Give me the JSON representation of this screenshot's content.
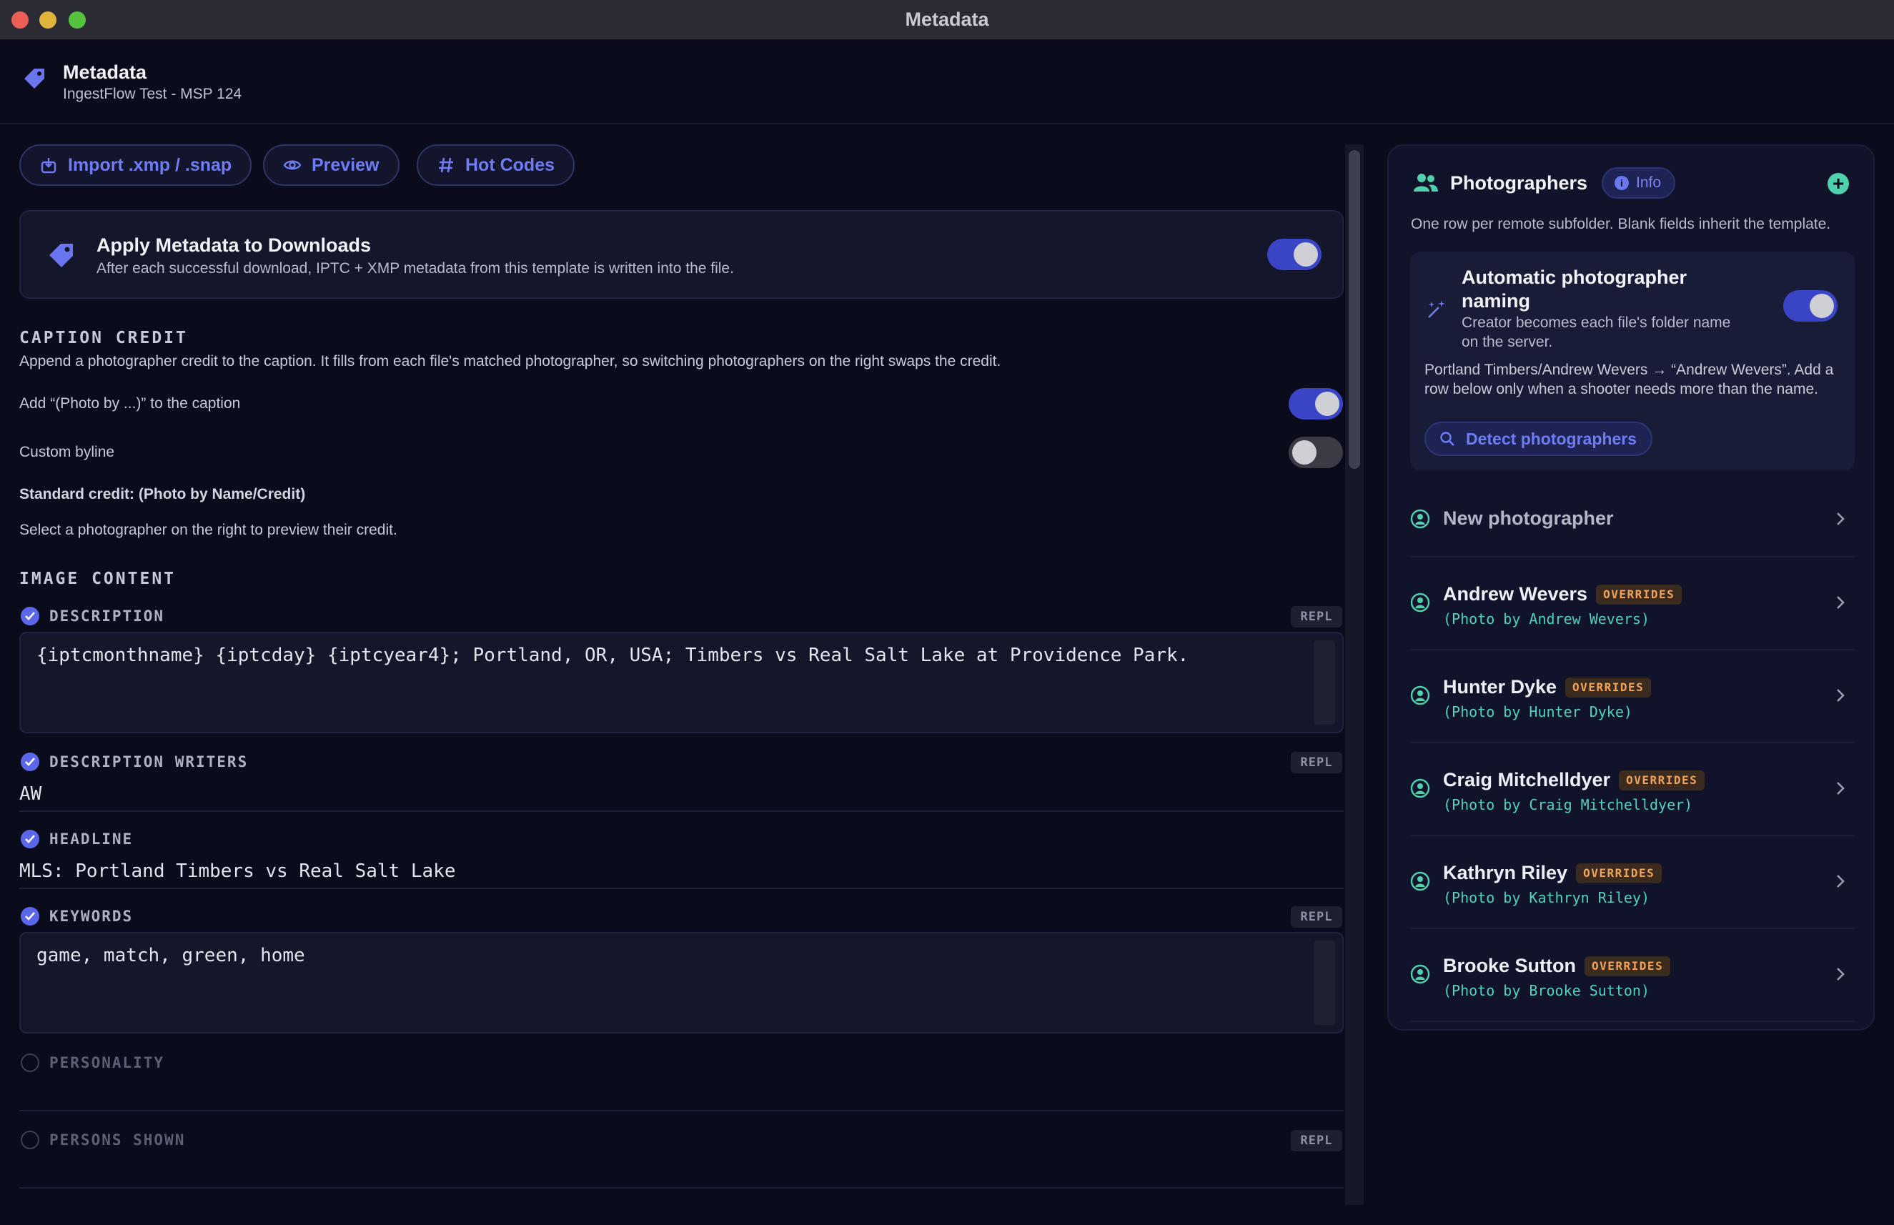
{
  "window": {
    "title": "Metadata"
  },
  "header": {
    "title": "Metadata",
    "subtitle": "IngestFlow Test - MSP 124"
  },
  "toolbar": {
    "import_label": "Import .xmp / .snap",
    "preview_label": "Preview",
    "hotcodes_label": "Hot Codes"
  },
  "apply": {
    "title": "Apply Metadata to Downloads",
    "subtitle": "After each successful download, IPTC + XMP metadata from this template is written into the file.",
    "enabled": true
  },
  "caption_credit": {
    "heading": "CAPTION CREDIT",
    "description": "Append a photographer credit to the caption. It fills from each file's matched photographer, so switching photographers on the right swaps the credit.",
    "add_photo_by_label": "Add “(Photo by ...)” to the caption",
    "add_photo_by_enabled": true,
    "custom_byline_label": "Custom byline",
    "custom_byline_enabled": false,
    "standard_credit": "Standard credit: (Photo by Name/Credit)",
    "hint": "Select a photographer on the right to preview their credit."
  },
  "image_content": {
    "heading": "IMAGE CONTENT",
    "repl_label": "REPL",
    "description": {
      "label": "DESCRIPTION",
      "checked": true,
      "value": "{iptcmonthname} {iptcday} {iptcyear4}; Portland, OR, USA; Timbers vs Real Salt Lake at Providence Park."
    },
    "description_writers": {
      "label": "DESCRIPTION WRITERS",
      "checked": true,
      "value": "AW"
    },
    "headline": {
      "label": "HEADLINE",
      "checked": true,
      "value": "MLS: Portland Timbers vs Real Salt Lake"
    },
    "keywords": {
      "label": "KEYWORDS",
      "checked": true,
      "value": "game, match, green, home"
    },
    "personality": {
      "label": "PERSONALITY",
      "checked": false,
      "value": ""
    },
    "persons_shown": {
      "label": "PERSONS SHOWN",
      "checked": false,
      "value": ""
    }
  },
  "photographers": {
    "title": "Photographers",
    "info_label": "Info",
    "subtitle": "One row per remote subfolder. Blank fields inherit the template.",
    "auto": {
      "title": "Automatic photographer naming",
      "subtitle": "Creator becomes each file's folder name on the server.",
      "note": "Portland Timbers/Andrew Wevers → “Andrew Wevers”. Add a row below only when a shooter needs more than the name.",
      "detect_label": "Detect photographers",
      "enabled": true
    },
    "new_label": "New photographer",
    "badge_label": "OVERRIDES",
    "rows": [
      {
        "name": "Andrew Wevers",
        "credit": "(Photo by Andrew Wevers)"
      },
      {
        "name": "Hunter Dyke",
        "credit": "(Photo by Hunter Dyke)"
      },
      {
        "name": "Craig Mitchelldyer",
        "credit": "(Photo by Craig Mitchelldyer)"
      },
      {
        "name": "Kathryn Riley",
        "credit": "(Photo by Kathryn Riley)"
      },
      {
        "name": "Brooke Sutton",
        "credit": "(Photo by Brooke Sutton)"
      }
    ]
  },
  "colors": {
    "accent": "#5a67e8",
    "teal": "#4fd1c0",
    "badge": "#f0a45a",
    "background": "#0b0c1b"
  }
}
